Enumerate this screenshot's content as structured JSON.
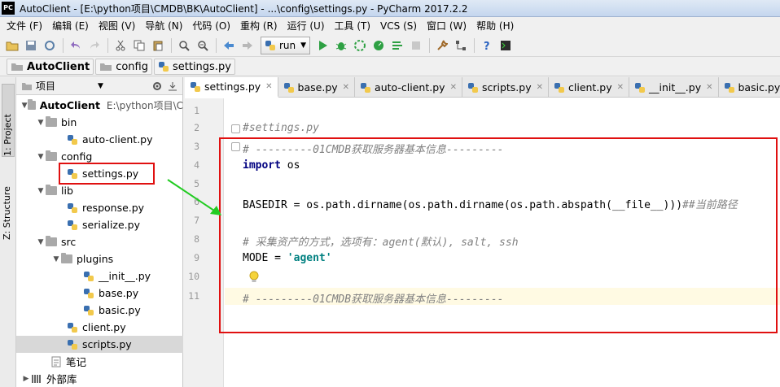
{
  "window": {
    "title": "AutoClient - [E:\\python项目\\CMDB\\BK\\AutoClient] - ...\\config\\settings.py - PyCharm 2017.2.2",
    "app_logo": "PC"
  },
  "menu": [
    "文件 (F)",
    "编辑 (E)",
    "视图 (V)",
    "导航 (N)",
    "代码 (O)",
    "重构 (R)",
    "运行 (U)",
    "工具 (T)",
    "VCS (S)",
    "窗口 (W)",
    "帮助 (H)"
  ],
  "toolbar": {
    "run_config_label": "run"
  },
  "breadcrumb": [
    "AutoClient",
    "config",
    "settings.py"
  ],
  "side_tabs": {
    "project": "1: Project",
    "structure": "Z: Structure"
  },
  "project_panel": {
    "title": "项目",
    "root_name": "AutoClient",
    "root_path": "E:\\python项目\\C",
    "items": [
      {
        "label": "bin",
        "kind": "folder"
      },
      {
        "label": "auto-client.py",
        "kind": "py"
      },
      {
        "label": "config",
        "kind": "folder"
      },
      {
        "label": "settings.py",
        "kind": "py"
      },
      {
        "label": "lib",
        "kind": "folder"
      },
      {
        "label": "response.py",
        "kind": "py"
      },
      {
        "label": "serialize.py",
        "kind": "py"
      },
      {
        "label": "src",
        "kind": "folder"
      },
      {
        "label": "plugins",
        "kind": "folder"
      },
      {
        "label": "__init__.py",
        "kind": "py"
      },
      {
        "label": "base.py",
        "kind": "py"
      },
      {
        "label": "basic.py",
        "kind": "py"
      },
      {
        "label": "client.py",
        "kind": "py"
      },
      {
        "label": "scripts.py",
        "kind": "py"
      },
      {
        "label": "笔记",
        "kind": "file"
      },
      {
        "label": "外部库",
        "kind": "lib"
      }
    ]
  },
  "editor": {
    "tabs": [
      "settings.py",
      "base.py",
      "auto-client.py",
      "scripts.py",
      "client.py",
      "__init__.py",
      "basic.py"
    ],
    "line_numbers": [
      "1",
      "2",
      "3",
      "4",
      "5",
      "6",
      "7",
      "8",
      "9",
      "10",
      "11"
    ],
    "code": {
      "l2": "#settings.py",
      "l3": "# ---------01CMDB获取服务器基本信息---------",
      "l4_kw": "import",
      "l4_rest": " os",
      "l6_code": "BASEDIR = os.path.dirname(os.path.dirname(os.path.abspath(__file__)))",
      "l6_cmt": "##当前路径",
      "l8": "# 采集资产的方式，选项有：agent(默认), salt, ssh",
      "l9_code": "MODE = ",
      "l9_str": "'agent'",
      "l11": "# ---------01CMDB获取服务器基本信息---------"
    }
  },
  "colors": {
    "annotation_red": "#e01010",
    "annotation_arrow_green": "#22cc22",
    "comment": "#808080",
    "keyword": "#000080",
    "string": "#008080"
  }
}
